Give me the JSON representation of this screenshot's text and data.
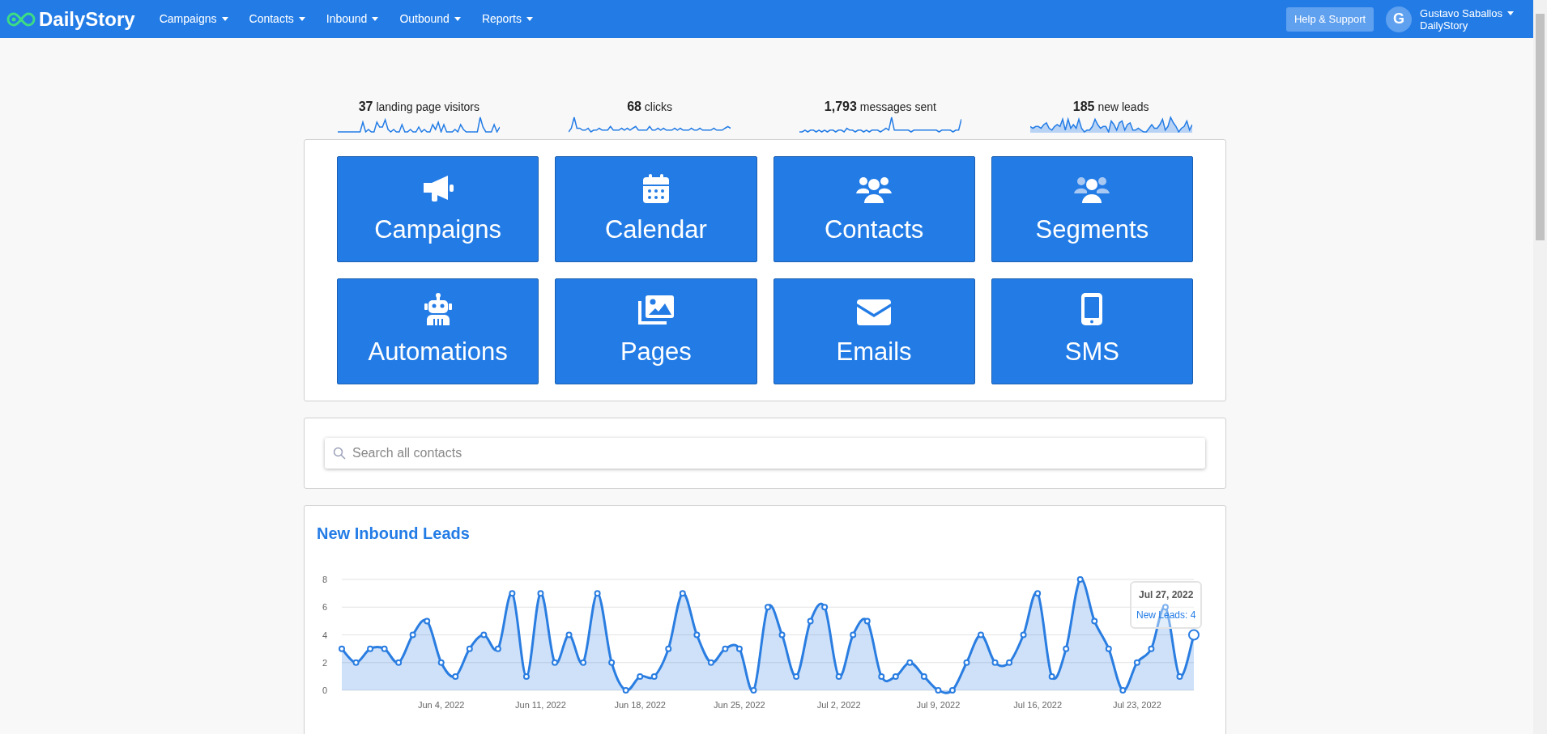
{
  "navbar": {
    "brand": "DailyStory",
    "menus": [
      {
        "label": "Campaigns"
      },
      {
        "label": "Contacts"
      },
      {
        "label": "Inbound"
      },
      {
        "label": "Outbound"
      },
      {
        "label": "Reports"
      }
    ],
    "help_button": "Help & Support",
    "user": {
      "initial": "G",
      "name": "Gustavo Saballos",
      "org": "DailyStory"
    }
  },
  "stats": [
    {
      "value": "37",
      "label": "landing page visitors",
      "kind": "line"
    },
    {
      "value": "68",
      "label": "clicks",
      "kind": "line"
    },
    {
      "value": "1,793",
      "label": "messages sent",
      "kind": "line"
    },
    {
      "value": "185",
      "label": "new leads",
      "kind": "area"
    }
  ],
  "tiles": [
    {
      "label": "Campaigns"
    },
    {
      "label": "Calendar"
    },
    {
      "label": "Contacts"
    },
    {
      "label": "Segments"
    },
    {
      "label": "Automations"
    },
    {
      "label": "Pages"
    },
    {
      "label": "Emails"
    },
    {
      "label": "SMS"
    }
  ],
  "search": {
    "placeholder": "Search all contacts"
  },
  "leads_panel": {
    "title": "New Inbound Leads",
    "chart_data": {
      "type": "area",
      "grid": true,
      "ylim": [
        0,
        8
      ],
      "yticks": [
        0,
        2,
        4,
        6,
        8
      ],
      "categories": [
        null,
        null,
        null,
        null,
        null,
        null,
        null,
        "Jun 4, 2022",
        null,
        null,
        null,
        null,
        null,
        null,
        "Jun 11, 2022",
        null,
        null,
        null,
        null,
        null,
        null,
        "Jun 18, 2022",
        null,
        null,
        null,
        null,
        null,
        null,
        "Jun 25, 2022",
        null,
        null,
        null,
        null,
        null,
        null,
        "Jul 2, 2022",
        null,
        null,
        null,
        null,
        null,
        null,
        "Jul 9, 2022",
        null,
        null,
        null,
        null,
        null,
        null,
        "Jul 16, 2022",
        null,
        null,
        null,
        null,
        null,
        null,
        "Jul 23, 2022",
        null,
        null,
        null,
        null
      ],
      "series": [
        {
          "color": "#2a7de1",
          "values": [
            3,
            2,
            3,
            3,
            2,
            4,
            5,
            2,
            1,
            3,
            4,
            3,
            7,
            1,
            7,
            2,
            4,
            2,
            7,
            2,
            0,
            1,
            1,
            3,
            7,
            4,
            2,
            3,
            3,
            0,
            6,
            4,
            1,
            5,
            6,
            1,
            4,
            5,
            1,
            1,
            2,
            1,
            0,
            0,
            2,
            4,
            2,
            2,
            4,
            7,
            1,
            3,
            8,
            5,
            3,
            0,
            2,
            3,
            6,
            1,
            4
          ]
        }
      ]
    },
    "tooltip": {
      "title": "Jul 27, 2022",
      "label": "New Leads: 4"
    }
  }
}
